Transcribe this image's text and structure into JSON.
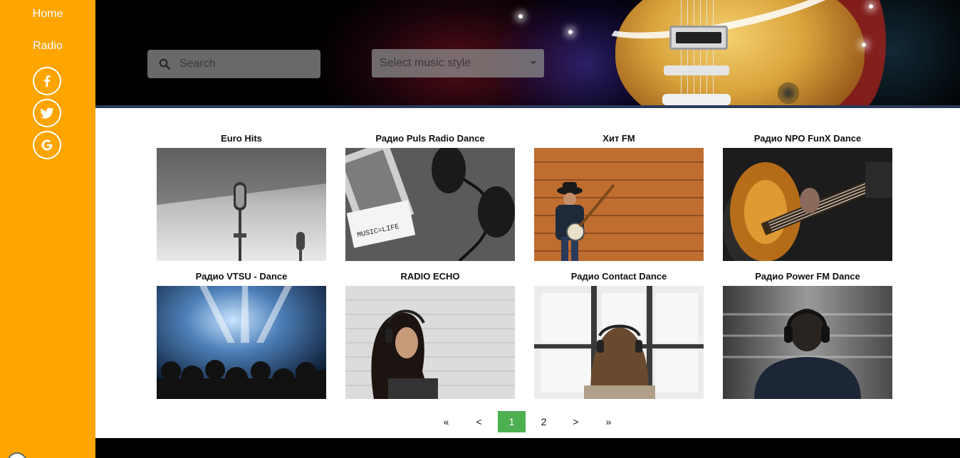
{
  "sidebar": {
    "nav": [
      {
        "label": "Home"
      },
      {
        "label": "Radio"
      }
    ],
    "social_icons": [
      "facebook-icon",
      "twitter-icon",
      "google-icon"
    ],
    "background": "#ffa500"
  },
  "search": {
    "placeholder": "Search"
  },
  "style_select": {
    "selected": "Select music style"
  },
  "stations": [
    {
      "title": "Euro Hits"
    },
    {
      "title": "Радио Puls Radio Dance"
    },
    {
      "title": "Хит FM"
    },
    {
      "title": "Радио NPO FunX Dance"
    },
    {
      "title": "Радио VTSU - Dance"
    },
    {
      "title": "RADIO ECHO"
    },
    {
      "title": "Радио Contact Dance"
    },
    {
      "title": "Радио Power FM Dance"
    }
  ],
  "thumbnail_text": {
    "note": "MUSIC=LIFE"
  },
  "pagination": {
    "first": "«",
    "prev": "<",
    "pages": [
      "1",
      "2"
    ],
    "current": "1",
    "next": ">",
    "last": "»"
  },
  "colors": {
    "accent": "#ffa500",
    "active_page": "#4caf50"
  }
}
